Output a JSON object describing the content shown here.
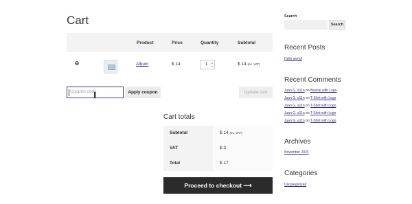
{
  "page": {
    "title": "Cart"
  },
  "cart_table": {
    "headers": {
      "product": "Product",
      "price": "Price",
      "quantity": "Quantity",
      "subtotal": "Subtotal"
    },
    "row": {
      "remove_symbol": "×",
      "product_name": "Album",
      "price": "$ 14",
      "quantity": "1",
      "subtotal": "$ 14",
      "subtotal_note": "(ex. VAT)"
    }
  },
  "coupon": {
    "placeholder": "Coupon code",
    "apply_label": "Apply coupon",
    "update_label": "Update cart"
  },
  "totals": {
    "title": "Cart totals",
    "subtotal_label": "Subtotal",
    "subtotal_value": "$ 14",
    "subtotal_note": "(ex. VAT)",
    "vat_label": "VAT",
    "vat_value": "$ 3",
    "total_label": "Total",
    "total_value": "$ 17",
    "checkout_label": "Proceed to checkout ⟶"
  },
  "sidebar": {
    "search_label": "Search",
    "search_button": "Search",
    "recent_posts_title": "Recent Posts",
    "recent_posts": [
      "Hello world!"
    ],
    "recent_comments_title": "Recent Comments",
    "comments": [
      {
        "author": "Juan G. a11n",
        "on": "on",
        "post": "Beanie with Logo"
      },
      {
        "author": "Juan G. a11n",
        "on": "on",
        "post": "T-Shirt with Logo"
      },
      {
        "author": "Juan G. a11n",
        "on": "on",
        "post": "T-Shirt with Logo"
      },
      {
        "author": "Juan G. a11n",
        "on": "on",
        "post": "T-Shirt with Logo"
      },
      {
        "author": "Juan G. a11n",
        "on": "on",
        "post": "T-Shirt with Logo"
      }
    ],
    "archives_title": "Archives",
    "archives": [
      "November 2023"
    ],
    "categories_title": "Categories",
    "categories": [
      "Uncategorized"
    ]
  }
}
